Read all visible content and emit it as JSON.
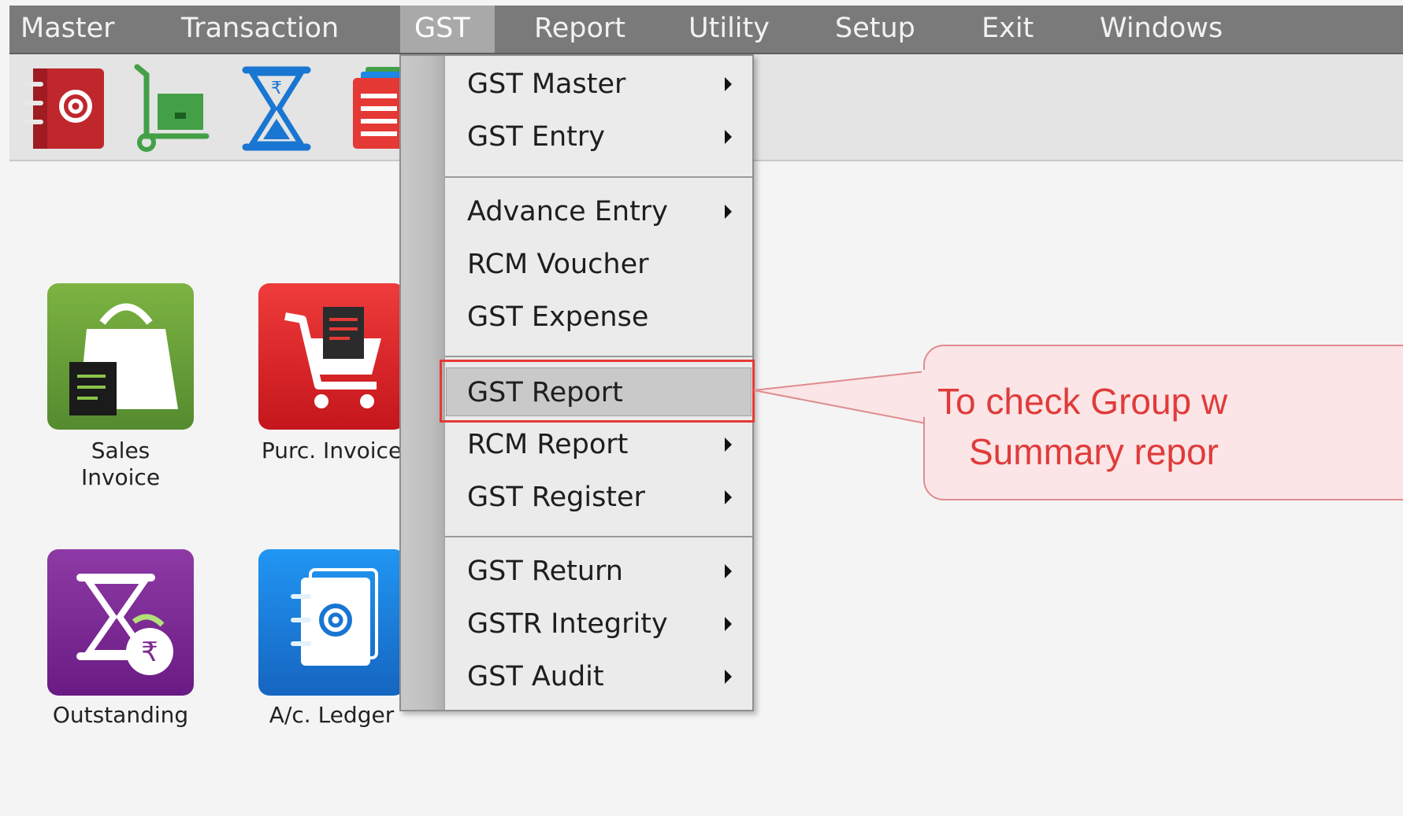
{
  "menubar": {
    "items": [
      {
        "label": "Master"
      },
      {
        "label": "Transaction"
      },
      {
        "label": "GST"
      },
      {
        "label": "Report"
      },
      {
        "label": "Utility"
      },
      {
        "label": "Setup"
      },
      {
        "label": "Exit"
      },
      {
        "label": "Windows"
      }
    ],
    "active": "GST"
  },
  "toolbar": {
    "icons": [
      "address-book-icon",
      "trolley-icon",
      "hourglass-rupee-icon",
      "report-list-icon"
    ]
  },
  "tiles": [
    {
      "label_line1": "Sales",
      "label_line2": "Invoice",
      "icon": "shopping-bag-icon",
      "color": "#6a9a3a"
    },
    {
      "label_line1": "Purc. Invoice",
      "label_line2": "",
      "icon": "cart-icon",
      "color": "#e01f26"
    },
    {
      "label_line1": "Outstanding",
      "label_line2": "",
      "icon": "hourglass-rupee-icon",
      "color": "#7b2a8e"
    },
    {
      "label_line1": "A/c. Ledger",
      "label_line2": "",
      "icon": "address-book-icon",
      "color": "#1a86c8"
    }
  ],
  "dropdown": {
    "items": [
      {
        "label": "GST Master",
        "submenu": true
      },
      {
        "label": "GST Entry",
        "submenu": true
      },
      {
        "label": "Advance Entry",
        "submenu": true
      },
      {
        "label": "RCM Voucher",
        "submenu": false
      },
      {
        "label": "GST Expense",
        "submenu": false
      },
      {
        "label": "GST Report",
        "submenu": false,
        "highlighted": true
      },
      {
        "label": "RCM Report",
        "submenu": true
      },
      {
        "label": "GST Register",
        "submenu": true
      },
      {
        "label": "GST Return",
        "submenu": true
      },
      {
        "label": "GSTR Integrity",
        "submenu": true
      },
      {
        "label": "GST Audit",
        "submenu": true
      }
    ]
  },
  "callout": {
    "line1": "To check Group w",
    "line2": "Summary repor"
  },
  "colors": {
    "menubar": "#7a7a7a",
    "highlight_box": "#e53935",
    "callout_text": "#e03b3b",
    "callout_bg": "#fbe5e6"
  }
}
